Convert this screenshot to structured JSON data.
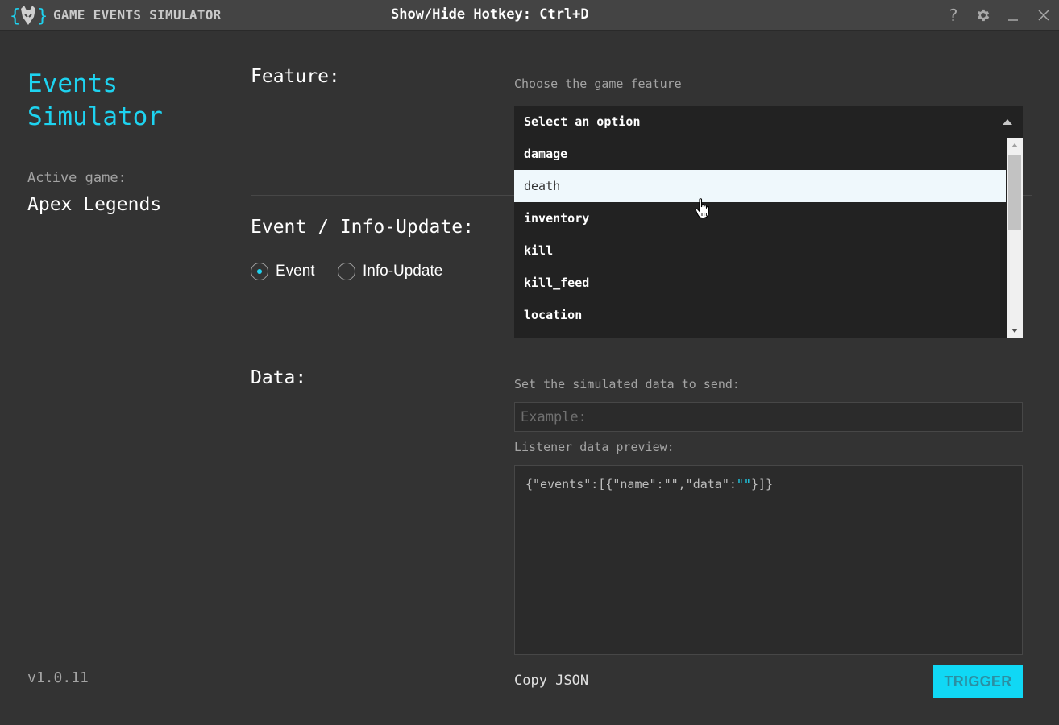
{
  "titlebar": {
    "app_title": "GAME EVENTS SIMULATOR",
    "hotkey_label": "Show/Hide Hotkey: Ctrl+D",
    "help_glyph": "?",
    "icons": [
      "logo-icon",
      "help-icon",
      "gear-icon",
      "minimize-icon",
      "close-icon"
    ]
  },
  "sidebar": {
    "brand_line1": "Events",
    "brand_line2": "Simulator",
    "active_game_label": "Active game:",
    "active_game": "Apex Legends",
    "version": "v1.0.11"
  },
  "feature": {
    "title": "Feature:",
    "hint": "Choose the game feature",
    "select_placeholder": "Select an option",
    "options": [
      "damage",
      "death",
      "inventory",
      "kill",
      "kill_feed",
      "location"
    ],
    "hovered_option": "death"
  },
  "event_type": {
    "title": "Event / Info-Update:",
    "options": [
      {
        "label": "Event",
        "checked": true
      },
      {
        "label": "Info-Update",
        "checked": false
      }
    ]
  },
  "data": {
    "title": "Data:",
    "hint": "Set the simulated data to send:",
    "input_placeholder": "Example:",
    "preview_label": "Listener data preview:",
    "preview_prefix": "{\"events\":[{\"name\":\"\",\"data\":",
    "preview_string": "\"\"",
    "preview_suffix": "}]}",
    "copy_label": "Copy JSON",
    "trigger_label": "TRIGGER"
  },
  "colors": {
    "accent": "#1ed3f0",
    "background": "#333333",
    "titlebar": "#444444",
    "dropdown_bg": "#222222",
    "hover_bg": "#eff8fc",
    "trigger_bg": "#10d8f5"
  }
}
